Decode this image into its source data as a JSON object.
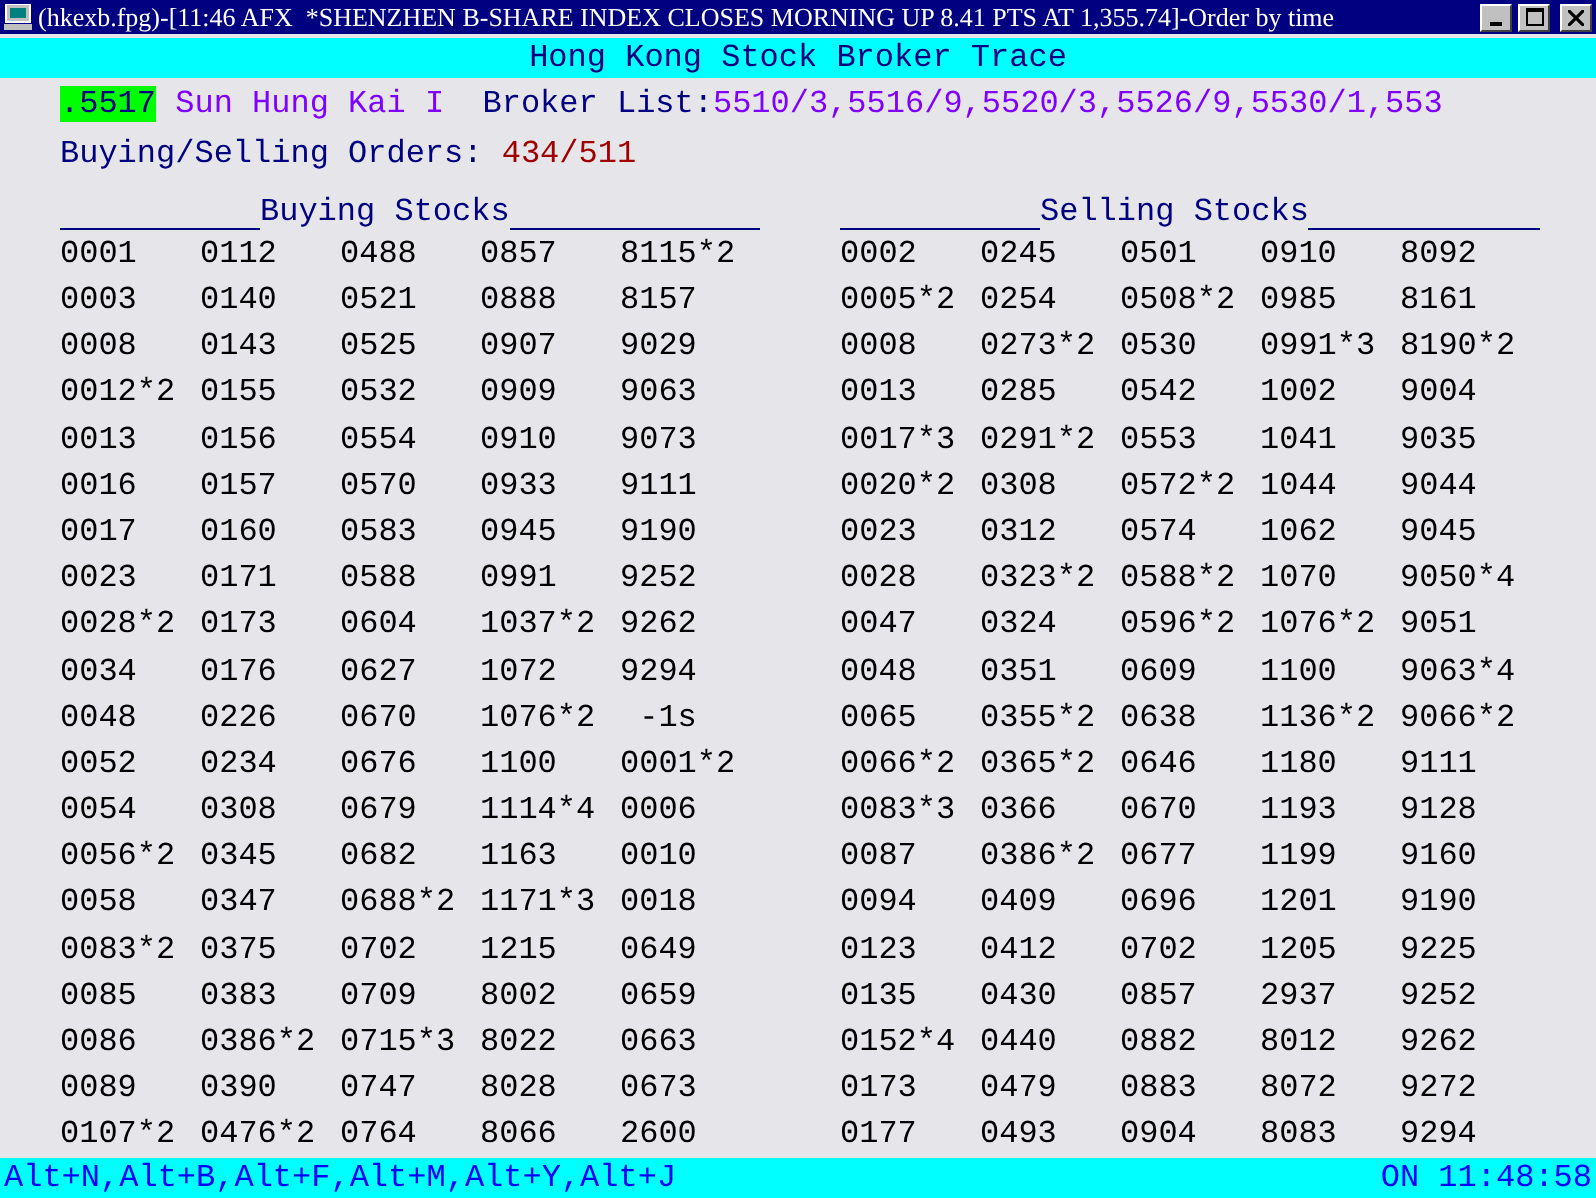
{
  "window": {
    "title": "(hkexb.fpg)-[11:46 AFX  *SHENZHEN B-SHARE INDEX CLOSES MORNING UP 8.41 PTS AT 1,355.74]-Order by time"
  },
  "header": {
    "title": "Hong Kong Stock Broker Trace"
  },
  "broker": {
    "code": ".5517",
    "name": "Sun Hung Kai I",
    "list_label": "Broker List:",
    "list": "5510/3,5516/9,5520/3,5526/9,5530/1,553"
  },
  "orders": {
    "label": "Buying/Selling Orders:",
    "value": "434/511"
  },
  "panels": [
    {
      "heading": "Buying Stocks",
      "rows": [
        [
          "0001",
          "0112",
          "0488",
          "0857",
          "8115*2"
        ],
        [
          "0003",
          "0140",
          "0521",
          "0888",
          "8157"
        ],
        [
          "0008",
          "0143",
          "0525",
          "0907",
          "9029"
        ],
        [
          "0012*2",
          "0155",
          "0532",
          "0909",
          "9063"
        ],
        [
          "0013",
          "0156",
          "0554",
          "0910",
          "9073"
        ],
        [
          "0016",
          "0157",
          "0570",
          "0933",
          "9111"
        ],
        [
          "0017",
          "0160",
          "0583",
          "0945",
          "9190"
        ],
        [
          "0023",
          "0171",
          "0588",
          "0991",
          "9252"
        ],
        [
          "0028*2",
          "0173",
          "0604",
          "1037*2",
          "9262"
        ],
        [
          "0034",
          "0176",
          "0627",
          "1072",
          "9294"
        ],
        [
          "0048",
          "0226",
          "0670",
          "1076*2",
          " -1s"
        ],
        [
          "0052",
          "0234",
          "0676",
          "1100",
          "0001*2"
        ],
        [
          "0054",
          "0308",
          "0679",
          "1114*4",
          "0006"
        ],
        [
          "0056*2",
          "0345",
          "0682",
          "1163",
          "0010"
        ],
        [
          "0058",
          "0347",
          "0688*2",
          "1171*3",
          "0018"
        ],
        [
          "0083*2",
          "0375",
          "0702",
          "1215",
          "0649"
        ],
        [
          "0085",
          "0383",
          "0709",
          "8002",
          "0659"
        ],
        [
          "0086",
          "0386*2",
          "0715*3",
          "8022",
          "0663"
        ],
        [
          "0089",
          "0390",
          "0747",
          "8028",
          "0673"
        ],
        [
          "0107*2",
          "0476*2",
          "0764",
          "8066",
          "2600"
        ]
      ]
    },
    {
      "heading": "Selling Stocks",
      "rows": [
        [
          "0002",
          "0245",
          "0501",
          "0910",
          "8092"
        ],
        [
          "0005*2",
          "0254",
          "0508*2",
          "0985",
          "8161"
        ],
        [
          "0008",
          "0273*2",
          "0530",
          "0991*3",
          "8190*2"
        ],
        [
          "0013",
          "0285",
          "0542",
          "1002",
          "9004"
        ],
        [
          "0017*3",
          "0291*2",
          "0553",
          "1041",
          "9035"
        ],
        [
          "0020*2",
          "0308",
          "0572*2",
          "1044",
          "9044"
        ],
        [
          "0023",
          "0312",
          "0574",
          "1062",
          "9045"
        ],
        [
          "0028",
          "0323*2",
          "0588*2",
          "1070",
          "9050*4"
        ],
        [
          "0047",
          "0324",
          "0596*2",
          "1076*2",
          "9051"
        ],
        [
          "0048",
          "0351",
          "0609",
          "1100",
          "9063*4"
        ],
        [
          "0065",
          "0355*2",
          "0638",
          "1136*2",
          "9066*2"
        ],
        [
          "0066*2",
          "0365*2",
          "0646",
          "1180",
          "9111"
        ],
        [
          "0083*3",
          "0366",
          "0670",
          "1193",
          "9128"
        ],
        [
          "0087",
          "0386*2",
          "0677",
          "1199",
          "9160"
        ],
        [
          "0094",
          "0409",
          "0696",
          "1201",
          "9190"
        ],
        [
          "0123",
          "0412",
          "0702",
          "1205",
          "9225"
        ],
        [
          "0135",
          "0430",
          "0857",
          "2937",
          "9252"
        ],
        [
          "0152*4",
          "0440",
          "0882",
          "8012",
          "9262"
        ],
        [
          "0173",
          "0479",
          "0883",
          "8072",
          "9272"
        ],
        [
          "0177",
          "0493",
          "0904",
          "8083",
          "9294"
        ]
      ]
    }
  ],
  "status_bar": {
    "keys": "Alt+N,Alt+B,Alt+F,Alt+M,Alt+Y,Alt+J",
    "clock": "ON 11:48:58"
  }
}
